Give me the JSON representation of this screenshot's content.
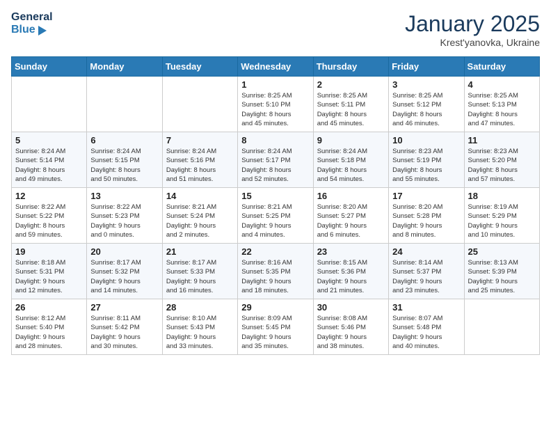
{
  "header": {
    "logo_line1": "General",
    "logo_line2": "Blue",
    "month": "January 2025",
    "location": "Krest'yanovka, Ukraine"
  },
  "weekdays": [
    "Sunday",
    "Monday",
    "Tuesday",
    "Wednesday",
    "Thursday",
    "Friday",
    "Saturday"
  ],
  "weeks": [
    [
      {
        "day": "",
        "info": ""
      },
      {
        "day": "",
        "info": ""
      },
      {
        "day": "",
        "info": ""
      },
      {
        "day": "1",
        "info": "Sunrise: 8:25 AM\nSunset: 5:10 PM\nDaylight: 8 hours\nand 45 minutes."
      },
      {
        "day": "2",
        "info": "Sunrise: 8:25 AM\nSunset: 5:11 PM\nDaylight: 8 hours\nand 45 minutes."
      },
      {
        "day": "3",
        "info": "Sunrise: 8:25 AM\nSunset: 5:12 PM\nDaylight: 8 hours\nand 46 minutes."
      },
      {
        "day": "4",
        "info": "Sunrise: 8:25 AM\nSunset: 5:13 PM\nDaylight: 8 hours\nand 47 minutes."
      }
    ],
    [
      {
        "day": "5",
        "info": "Sunrise: 8:24 AM\nSunset: 5:14 PM\nDaylight: 8 hours\nand 49 minutes."
      },
      {
        "day": "6",
        "info": "Sunrise: 8:24 AM\nSunset: 5:15 PM\nDaylight: 8 hours\nand 50 minutes."
      },
      {
        "day": "7",
        "info": "Sunrise: 8:24 AM\nSunset: 5:16 PM\nDaylight: 8 hours\nand 51 minutes."
      },
      {
        "day": "8",
        "info": "Sunrise: 8:24 AM\nSunset: 5:17 PM\nDaylight: 8 hours\nand 52 minutes."
      },
      {
        "day": "9",
        "info": "Sunrise: 8:24 AM\nSunset: 5:18 PM\nDaylight: 8 hours\nand 54 minutes."
      },
      {
        "day": "10",
        "info": "Sunrise: 8:23 AM\nSunset: 5:19 PM\nDaylight: 8 hours\nand 55 minutes."
      },
      {
        "day": "11",
        "info": "Sunrise: 8:23 AM\nSunset: 5:20 PM\nDaylight: 8 hours\nand 57 minutes."
      }
    ],
    [
      {
        "day": "12",
        "info": "Sunrise: 8:22 AM\nSunset: 5:22 PM\nDaylight: 8 hours\nand 59 minutes."
      },
      {
        "day": "13",
        "info": "Sunrise: 8:22 AM\nSunset: 5:23 PM\nDaylight: 9 hours\nand 0 minutes."
      },
      {
        "day": "14",
        "info": "Sunrise: 8:21 AM\nSunset: 5:24 PM\nDaylight: 9 hours\nand 2 minutes."
      },
      {
        "day": "15",
        "info": "Sunrise: 8:21 AM\nSunset: 5:25 PM\nDaylight: 9 hours\nand 4 minutes."
      },
      {
        "day": "16",
        "info": "Sunrise: 8:20 AM\nSunset: 5:27 PM\nDaylight: 9 hours\nand 6 minutes."
      },
      {
        "day": "17",
        "info": "Sunrise: 8:20 AM\nSunset: 5:28 PM\nDaylight: 9 hours\nand 8 minutes."
      },
      {
        "day": "18",
        "info": "Sunrise: 8:19 AM\nSunset: 5:29 PM\nDaylight: 9 hours\nand 10 minutes."
      }
    ],
    [
      {
        "day": "19",
        "info": "Sunrise: 8:18 AM\nSunset: 5:31 PM\nDaylight: 9 hours\nand 12 minutes."
      },
      {
        "day": "20",
        "info": "Sunrise: 8:17 AM\nSunset: 5:32 PM\nDaylight: 9 hours\nand 14 minutes."
      },
      {
        "day": "21",
        "info": "Sunrise: 8:17 AM\nSunset: 5:33 PM\nDaylight: 9 hours\nand 16 minutes."
      },
      {
        "day": "22",
        "info": "Sunrise: 8:16 AM\nSunset: 5:35 PM\nDaylight: 9 hours\nand 18 minutes."
      },
      {
        "day": "23",
        "info": "Sunrise: 8:15 AM\nSunset: 5:36 PM\nDaylight: 9 hours\nand 21 minutes."
      },
      {
        "day": "24",
        "info": "Sunrise: 8:14 AM\nSunset: 5:37 PM\nDaylight: 9 hours\nand 23 minutes."
      },
      {
        "day": "25",
        "info": "Sunrise: 8:13 AM\nSunset: 5:39 PM\nDaylight: 9 hours\nand 25 minutes."
      }
    ],
    [
      {
        "day": "26",
        "info": "Sunrise: 8:12 AM\nSunset: 5:40 PM\nDaylight: 9 hours\nand 28 minutes."
      },
      {
        "day": "27",
        "info": "Sunrise: 8:11 AM\nSunset: 5:42 PM\nDaylight: 9 hours\nand 30 minutes."
      },
      {
        "day": "28",
        "info": "Sunrise: 8:10 AM\nSunset: 5:43 PM\nDaylight: 9 hours\nand 33 minutes."
      },
      {
        "day": "29",
        "info": "Sunrise: 8:09 AM\nSunset: 5:45 PM\nDaylight: 9 hours\nand 35 minutes."
      },
      {
        "day": "30",
        "info": "Sunrise: 8:08 AM\nSunset: 5:46 PM\nDaylight: 9 hours\nand 38 minutes."
      },
      {
        "day": "31",
        "info": "Sunrise: 8:07 AM\nSunset: 5:48 PM\nDaylight: 9 hours\nand 40 minutes."
      },
      {
        "day": "",
        "info": ""
      }
    ]
  ]
}
